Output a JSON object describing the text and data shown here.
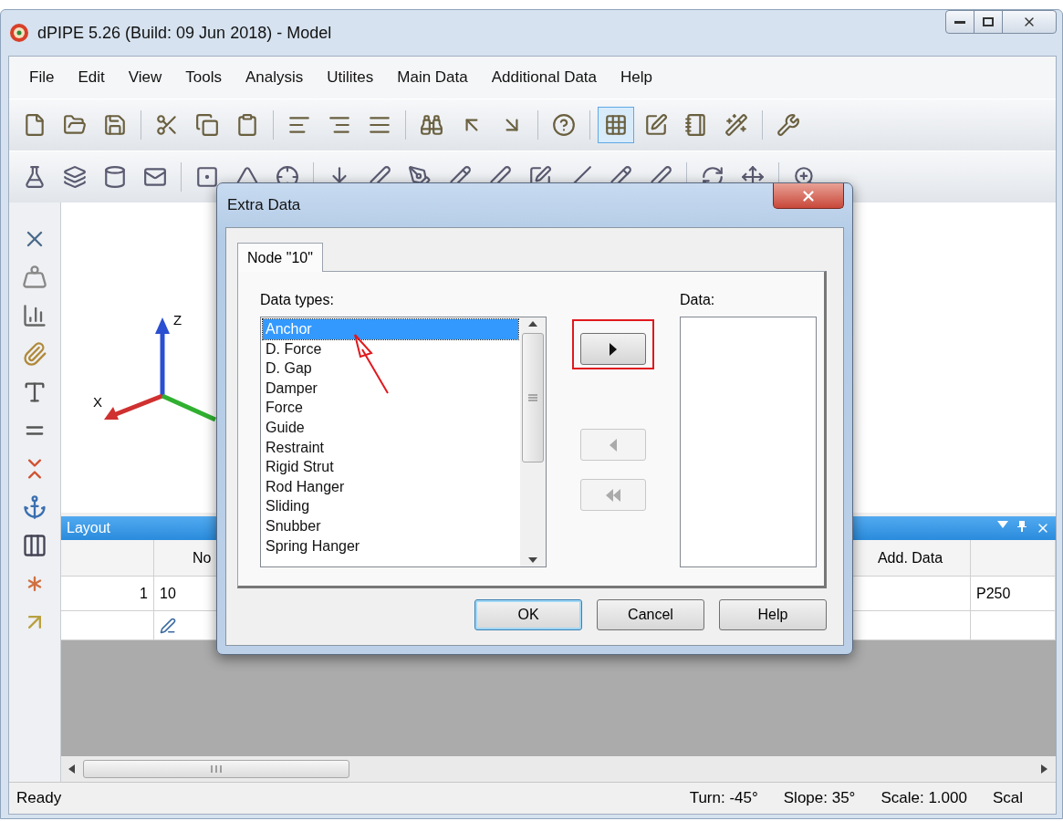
{
  "window": {
    "title": "dPIPE 5.26 (Build: 09 Jun 2018) - Model"
  },
  "menu": [
    "File",
    "Edit",
    "View",
    "Tools",
    "Analysis",
    "Utilites",
    "Main Data",
    "Additional Data",
    "Help"
  ],
  "toolbar_top": [
    {
      "pressed": false
    },
    {
      "pressed": false
    },
    {
      "pressed": false
    },
    {
      "pressed": false
    },
    {
      "pressed": false
    },
    {
      "pressed": false
    },
    {
      "pressed": false
    },
    {
      "pressed": false
    },
    {
      "pressed": false
    },
    {
      "pressed": false
    },
    {
      "pressed": false
    },
    {
      "pressed": false
    },
    {
      "pressed": false
    },
    {
      "pressed": true
    },
    {
      "pressed": false
    },
    {
      "pressed": false
    },
    {
      "pressed": false
    },
    {
      "pressed": false
    }
  ],
  "axes": {
    "z_label": "Z",
    "x_label": "X"
  },
  "layout_panel": {
    "title": "Layout",
    "columns": [
      "",
      "No",
      "Add. Data",
      ""
    ],
    "rows": [
      [
        "1",
        "10",
        "",
        "P250"
      ]
    ]
  },
  "dialog": {
    "title": "Extra Data",
    "tabs": [
      {
        "label": "Node \"10\"",
        "selected": true
      }
    ],
    "data_types_label": "Data types:",
    "data_types": [
      {
        "label": "Anchor",
        "selected": true
      },
      {
        "label": "D. Force",
        "selected": false
      },
      {
        "label": "D. Gap",
        "selected": false
      },
      {
        "label": "Damper",
        "selected": false
      },
      {
        "label": "Force",
        "selected": false
      },
      {
        "label": "Guide",
        "selected": false
      },
      {
        "label": "Restraint",
        "selected": false
      },
      {
        "label": "Rigid Strut",
        "selected": false
      },
      {
        "label": "Rod Hanger",
        "selected": false
      },
      {
        "label": "Sliding",
        "selected": false
      },
      {
        "label": "Snubber",
        "selected": false
      },
      {
        "label": "Spring Hanger",
        "selected": false
      }
    ],
    "data_label": "Data:",
    "move_buttons": [
      {
        "kind": "add",
        "disabled": false,
        "highlighted": true
      },
      {
        "kind": "remove",
        "disabled": true,
        "highlighted": false
      },
      {
        "kind": "remove_all",
        "disabled": true,
        "highlighted": false
      }
    ],
    "buttons": [
      {
        "label": "OK",
        "default": true
      },
      {
        "label": "Cancel",
        "default": false
      },
      {
        "label": "Help",
        "default": false
      }
    ]
  },
  "status_bar": [
    "Ready",
    "Turn: -45°",
    "Slope: 35°",
    "Scale: 1.000",
    "Scal"
  ]
}
